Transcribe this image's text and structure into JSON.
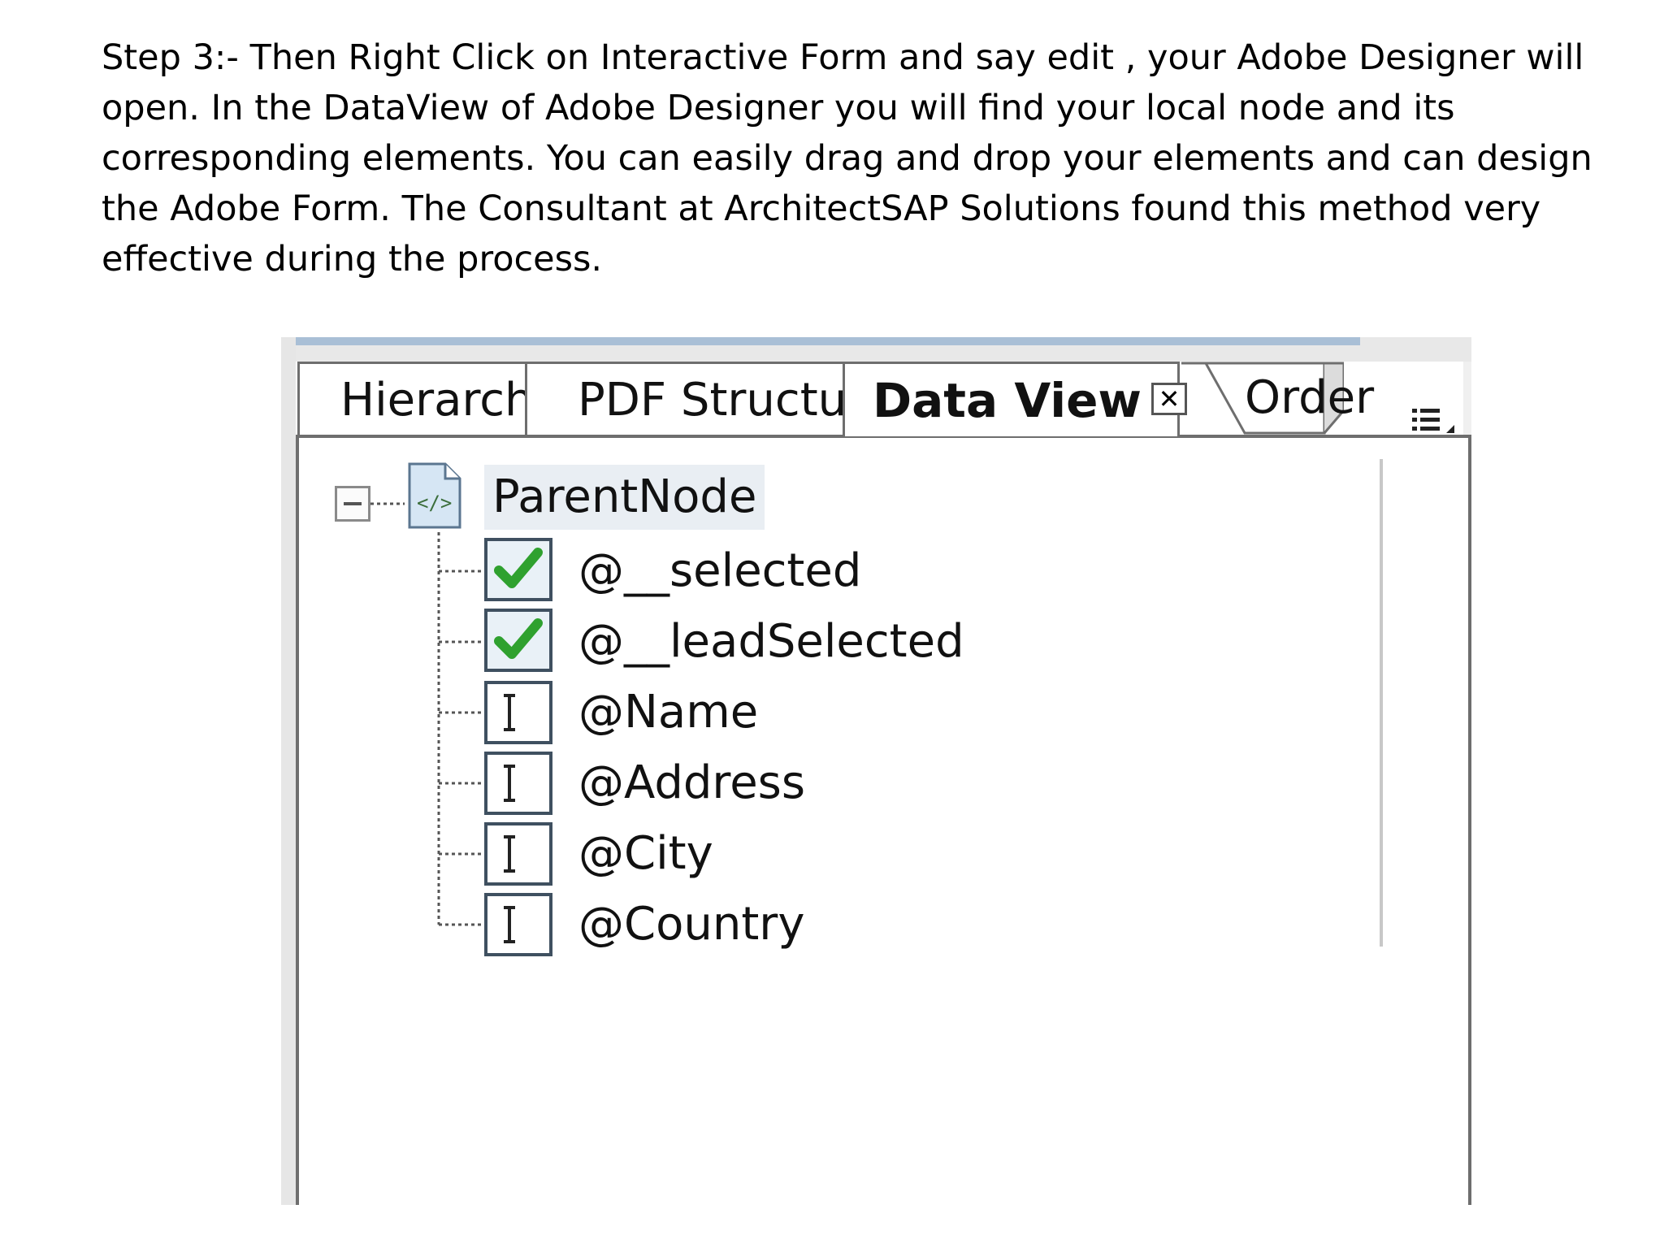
{
  "paragraph": {
    "line1": "Step 3:-  Then Right Click on Interactive Form and say edit , your Adobe Designer will",
    "line2": "open. In the DataView of Adobe Designer you will find your local node and its",
    "line3": "corresponding elements. You can easily drag and drop your elements and can design",
    "line4": "the Adobe Form. The Consultant at ArchitectSAP Solutions found this method very",
    "line5": "effective during the process."
  },
  "tabs": {
    "hierarchy": "Hierarch",
    "pdf_structure": "PDF Structu",
    "data_view": "Data View",
    "order": "Order"
  },
  "tree": {
    "parent_node": "ParentNode",
    "items": [
      {
        "label": "@__selected",
        "icon": "checkbox-checked-icon"
      },
      {
        "label": "@__leadSelected",
        "icon": "checkbox-checked-icon"
      },
      {
        "label": "@Name",
        "icon": "text-field-icon"
      },
      {
        "label": "@Address",
        "icon": "text-field-icon"
      },
      {
        "label": "@City",
        "icon": "text-field-icon"
      },
      {
        "label": "@Country",
        "icon": "text-field-icon"
      }
    ]
  },
  "colors": {
    "check_green": "#2fa12f",
    "selection_bg": "#e9eef3",
    "border": "#6e6e6e"
  }
}
